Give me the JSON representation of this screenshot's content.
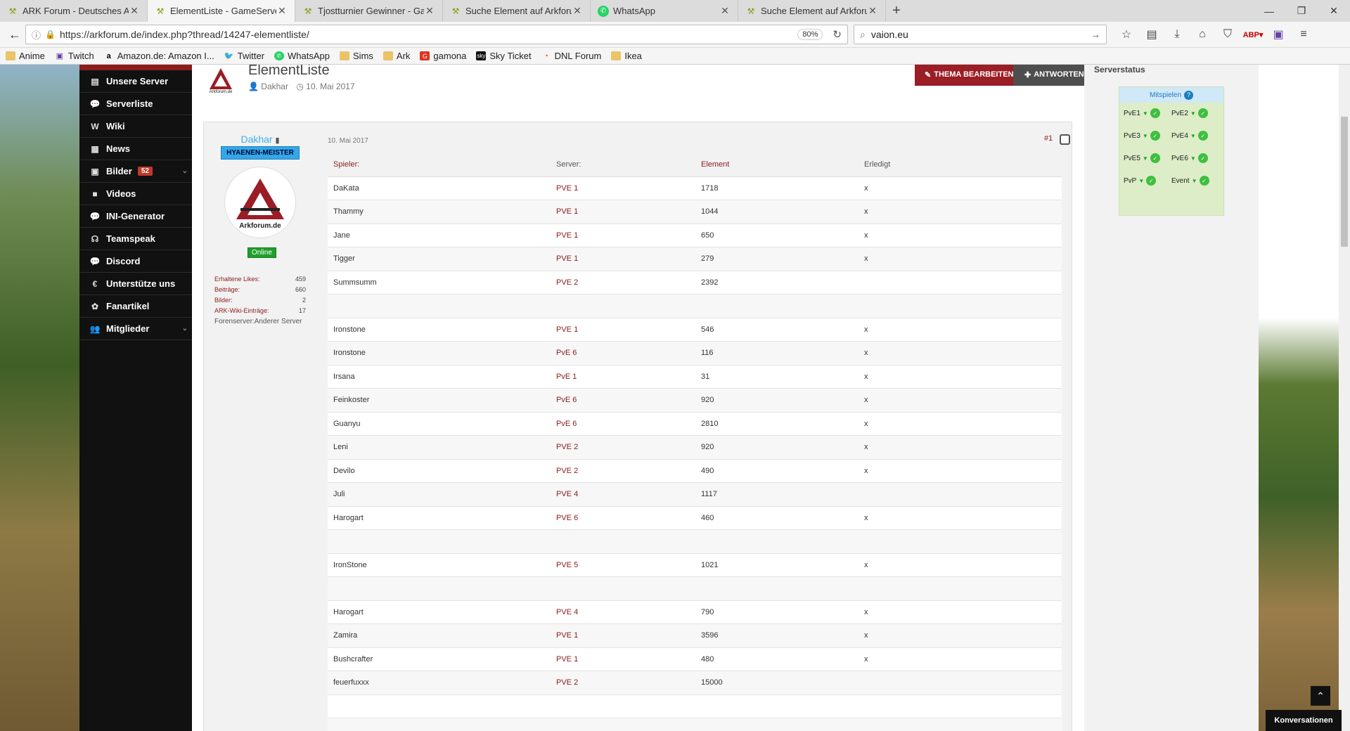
{
  "tabs": [
    {
      "title": "ARK Forum - Deutsches ARK",
      "active": false,
      "icon": "ark-favicon"
    },
    {
      "title": "ElementListe - GameServer -",
      "active": true,
      "icon": "ark-favicon"
    },
    {
      "title": "Tjostturnier Gewinner - Gam",
      "active": false,
      "icon": "ark-favicon"
    },
    {
      "title": "Suche Element auf Arkforum",
      "active": false,
      "icon": "ark-favicon"
    },
    {
      "title": "WhatsApp",
      "active": false,
      "icon": "whatsapp-icon"
    },
    {
      "title": "Suche Element auf Arkforum",
      "active": false,
      "icon": "ark-favicon"
    }
  ],
  "url": "https://arkforum.de/index.php?thread/14247-elementliste/",
  "zoom": "80%",
  "search": "vaion.eu",
  "bookmarks": [
    {
      "label": "Anime",
      "icon": "folder"
    },
    {
      "label": "Twitch",
      "icon": "twitch"
    },
    {
      "label": "Amazon.de: Amazon I...",
      "icon": "amazon"
    },
    {
      "label": "Twitter",
      "icon": "twitter"
    },
    {
      "label": "WhatsApp",
      "icon": "whatsapp"
    },
    {
      "label": "Sims",
      "icon": "folder"
    },
    {
      "label": "Ark",
      "icon": "folder"
    },
    {
      "label": "gamona",
      "icon": "gamona"
    },
    {
      "label": "Sky Ticket",
      "icon": "sky"
    },
    {
      "label": "DNL Forum",
      "icon": "dnl"
    },
    {
      "label": "Ikea",
      "icon": "folder"
    }
  ],
  "nav": [
    {
      "label": "Unsere Server",
      "icon": "server-icon"
    },
    {
      "label": "Serverliste",
      "icon": "chat-icon"
    },
    {
      "label": "Wiki",
      "icon": "wiki-icon"
    },
    {
      "label": "News",
      "icon": "news-icon"
    },
    {
      "label": "Bilder",
      "icon": "image-icon",
      "badge": "52",
      "caret": true
    },
    {
      "label": "Videos",
      "icon": "video-icon"
    },
    {
      "label": "INI-Generator",
      "icon": "chat-icon"
    },
    {
      "label": "Teamspeak",
      "icon": "headset-icon"
    },
    {
      "label": "Discord",
      "icon": "chat-icon"
    },
    {
      "label": "Unterstütze uns",
      "icon": "euro-icon"
    },
    {
      "label": "Fanartikel",
      "icon": "gift-icon"
    },
    {
      "label": "Mitglieder",
      "icon": "users-icon",
      "caret": true
    }
  ],
  "thread": {
    "title": "ElementListe",
    "author": "Dakhar",
    "date": "10. Mai 2017",
    "edit_label": "THEMA BEARBEITEN",
    "reply_label": "ANTWORTEN"
  },
  "post": {
    "username": "Dakhar",
    "rank": "HYAENEN-MEISTER",
    "online": "Online",
    "avatar_text": "Arkforum.de",
    "stats": [
      {
        "k": "Erhaltene Likes:",
        "v": "459"
      },
      {
        "k": "Beiträge:",
        "v": "660"
      },
      {
        "k": "Bilder:",
        "v": "2"
      },
      {
        "k": "ARK-Wiki-Einträge:",
        "v": "17"
      }
    ],
    "forenserver_label": "Forenserver:",
    "forenserver": "Anderer Server",
    "date": "10. Mai 2017",
    "number": "#1"
  },
  "table": {
    "headers": [
      "Spieler:",
      "Server:",
      "Element",
      "Erledigt"
    ],
    "rows": [
      [
        "DaKata",
        "PVE 1",
        "1718",
        "x"
      ],
      [
        "Thammy",
        "PVE 1",
        "1044",
        "x"
      ],
      [
        "Jane",
        "PVE 1",
        "650",
        "x"
      ],
      [
        "Tigger",
        "PVE 1",
        "279",
        "x"
      ],
      [
        "Summsumm",
        "PVE 2",
        "2392",
        ""
      ],
      [
        "",
        "",
        "",
        ""
      ],
      [
        "Ironstone",
        "PVE 1",
        "546",
        "x"
      ],
      [
        "Ironstone",
        "PvE 6",
        "116",
        "x"
      ],
      [
        "Irsana",
        "PvE 1",
        "31",
        "x"
      ],
      [
        "Feinkoster",
        "PvE 6",
        "920",
        "x"
      ],
      [
        "Guanyu",
        "PvE 6",
        "2810",
        "x"
      ],
      [
        "Leni",
        "PVE 2",
        "920",
        "x"
      ],
      [
        "Devilo",
        "PVE 2",
        "490",
        "x"
      ],
      [
        "Juli",
        "PVE 4",
        "1117",
        ""
      ],
      [
        "Harogart",
        "PVE 6",
        "460",
        "x"
      ],
      [
        "",
        "",
        "",
        ""
      ],
      [
        "IronStone",
        "PVE 5",
        "1021",
        "x"
      ],
      [
        "",
        "",
        "",
        ""
      ],
      [
        "Harogart",
        "PVE 4",
        "790",
        "x"
      ],
      [
        "Zamira",
        "PVE 1",
        "3596",
        "x"
      ],
      [
        "Bushcrafter",
        "PVE 1",
        "480",
        "x"
      ],
      [
        "feuerfuxxx",
        "PVE 2",
        "15000",
        ""
      ],
      [
        "",
        "",
        "",
        ""
      ],
      [
        "",
        "",
        "",
        ""
      ],
      [
        "",
        "",
        "",
        ""
      ]
    ]
  },
  "serverstatus": {
    "title": "Serverstatus",
    "join": "Mitspielen",
    "servers": [
      "PvE1",
      "PvE2",
      "PvE3",
      "PvE4",
      "PvE5",
      "PvE6",
      "PvP",
      "Event"
    ]
  },
  "konversationen": "Konversationen"
}
